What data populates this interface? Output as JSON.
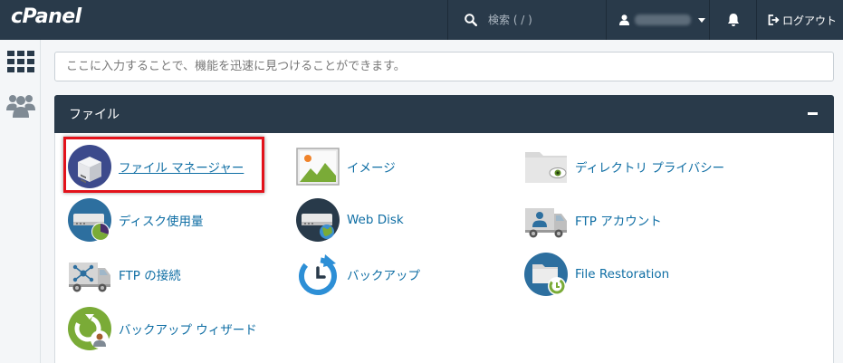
{
  "header": {
    "logo_text": "cPanel",
    "search_placeholder": "検索 ( / )",
    "user_name": "username",
    "logout_label": "ログアウト"
  },
  "sidebar": {
    "items": [
      {
        "name": "apps-grid-icon"
      },
      {
        "name": "users-icon"
      }
    ]
  },
  "main": {
    "quick_search_placeholder": "ここに入力することで、機能を迅速に見つけることができます。"
  },
  "section": {
    "title": "ファイル",
    "items": [
      {
        "label": "ファイル マネージャー",
        "icon": "file-manager-icon"
      },
      {
        "label": "イメージ",
        "icon": "image-icon"
      },
      {
        "label": "ディレクトリ プライバシー",
        "icon": "directory-privacy-icon"
      },
      {
        "label": "ディスク使用量",
        "icon": "disk-usage-icon"
      },
      {
        "label": "Web Disk",
        "icon": "web-disk-icon"
      },
      {
        "label": "FTP アカウント",
        "icon": "ftp-accounts-icon"
      },
      {
        "label": "FTP の接続",
        "icon": "ftp-connections-icon"
      },
      {
        "label": "バックアップ",
        "icon": "backup-icon"
      },
      {
        "label": "File Restoration",
        "icon": "file-restoration-icon"
      },
      {
        "label": "バックアップ ウィザード",
        "icon": "backup-wizard-icon"
      }
    ]
  },
  "colors": {
    "header_bg": "#293a4a",
    "link": "#0f6ea4",
    "highlight": "#e3121b"
  }
}
